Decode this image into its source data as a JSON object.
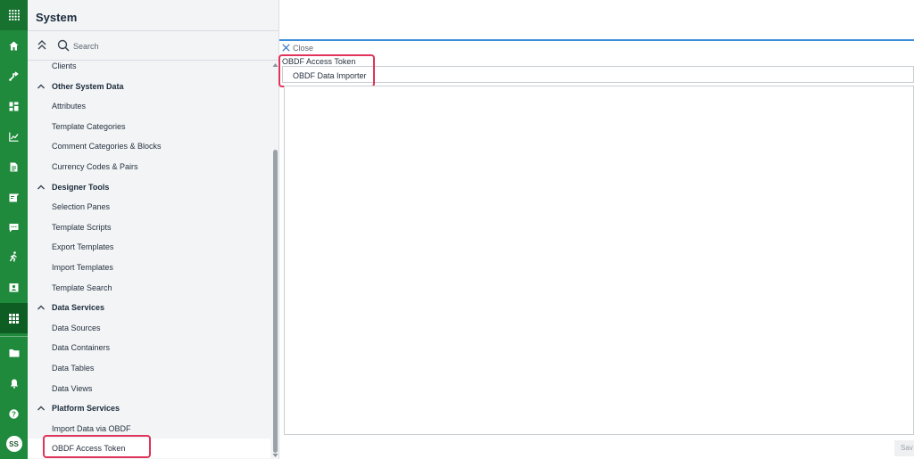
{
  "panel": {
    "title": "System",
    "search_placeholder": "Search"
  },
  "nav": {
    "rows": [
      {
        "type": "item",
        "label": "Clients"
      },
      {
        "type": "group",
        "label": "Other System Data"
      },
      {
        "type": "item",
        "label": "Attributes"
      },
      {
        "type": "item",
        "label": "Template Categories"
      },
      {
        "type": "item",
        "label": "Comment Categories & Blocks"
      },
      {
        "type": "item",
        "label": "Currency Codes & Pairs"
      },
      {
        "type": "group",
        "label": "Designer Tools"
      },
      {
        "type": "item",
        "label": "Selection Panes"
      },
      {
        "type": "item",
        "label": "Template Scripts"
      },
      {
        "type": "item",
        "label": "Export Templates"
      },
      {
        "type": "item",
        "label": "Import Templates"
      },
      {
        "type": "item",
        "label": "Template Search"
      },
      {
        "type": "group",
        "label": "Data Services"
      },
      {
        "type": "item",
        "label": "Data Sources"
      },
      {
        "type": "item",
        "label": "Data Containers"
      },
      {
        "type": "item",
        "label": "Data Tables"
      },
      {
        "type": "item",
        "label": "Data Views"
      },
      {
        "type": "group",
        "label": "Platform Services"
      },
      {
        "type": "item",
        "label": "Import Data via OBDF"
      },
      {
        "type": "item",
        "label": "OBDF Access Token",
        "selected": true
      }
    ]
  },
  "rail": {
    "icons": [
      "apps-grid-icon",
      "home-icon",
      "workflow-icon",
      "dashboard-icon",
      "analytics-icon",
      "document-icon",
      "notes-icon",
      "chat-icon",
      "activity-icon",
      "contacts-icon",
      "system-icon",
      "folder-icon",
      "bell-icon",
      "help-icon"
    ],
    "user_initials": "SS"
  },
  "main": {
    "close_label": "Close",
    "doc_title": "OBDF Access Token",
    "tab_label": "OBDF Data Importer",
    "save_label": "Sav"
  },
  "colors": {
    "rail_green": "#1f8a3c",
    "rail_active": "#0e5e24",
    "accent_blue": "#3a8fd8",
    "highlight_red": "#e0345a"
  }
}
